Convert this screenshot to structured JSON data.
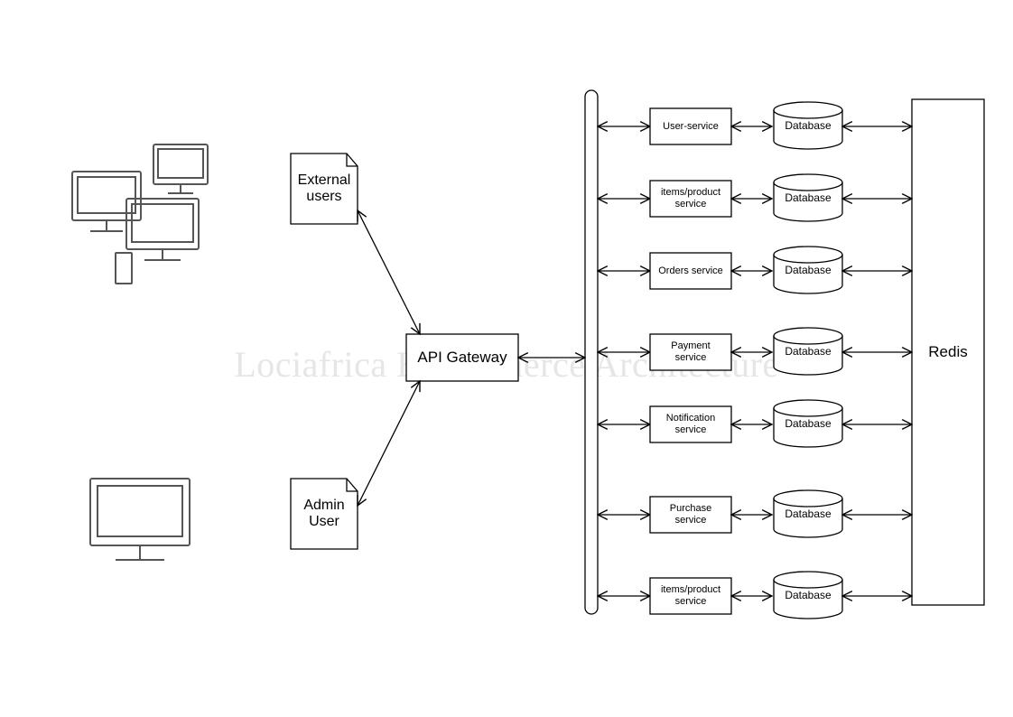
{
  "watermark": "Lociafrica E-commerce Architecture",
  "external_users": "External\nusers",
  "admin_user": "Admin\nUser",
  "api_gateway": "API Gateway",
  "redis": "Redis",
  "services": [
    {
      "name": "User-service",
      "db": "Database"
    },
    {
      "name": "items/product\nservice",
      "db": "Database"
    },
    {
      "name": "Orders service",
      "db": "Database"
    },
    {
      "name": "Payment\nservice",
      "db": "Database"
    },
    {
      "name": "Notification\nservice",
      "db": "Database"
    },
    {
      "name": "Purchase\nservice",
      "db": "Database"
    },
    {
      "name": "items/product\nservice",
      "db": "Database"
    }
  ]
}
